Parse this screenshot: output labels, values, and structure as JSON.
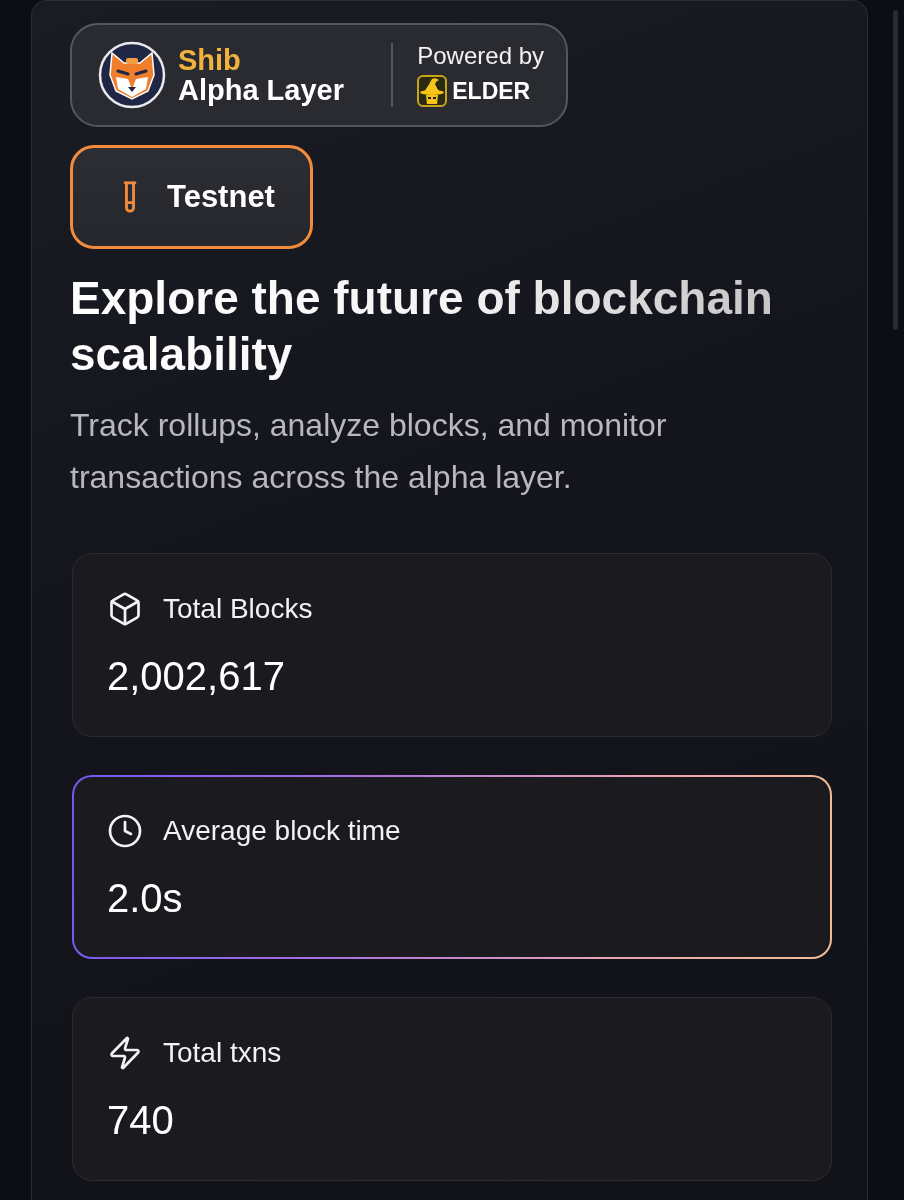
{
  "brand": {
    "name_line_1": "Shib",
    "name_line_2": "Alpha Layer",
    "powered_by": "Powered by",
    "partner": "ELDER"
  },
  "network_badge": {
    "label": "Testnet"
  },
  "hero": {
    "title": "Explore the future of blockchain scalability",
    "subtitle": "Track rollups, analyze blocks, and monitor transactions across the alpha layer."
  },
  "stats": [
    {
      "kind": "blocks",
      "label": "Total Blocks",
      "value": "2,002,617",
      "highlighted": false
    },
    {
      "kind": "time",
      "label": "Average block time",
      "value": "2.0s",
      "highlighted": true
    },
    {
      "kind": "txns",
      "label": "Total txns",
      "value": "740",
      "highlighted": false
    }
  ]
}
